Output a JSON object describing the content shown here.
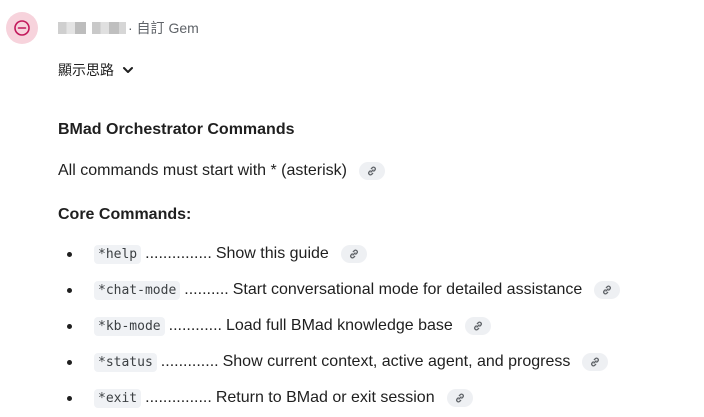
{
  "header": {
    "author_suffix": "· 自訂 Gem"
  },
  "thinking": {
    "label": "顯示思路"
  },
  "content": {
    "title": "BMad Orchestrator Commands",
    "intro": "All commands must start with * (asterisk)",
    "section_title": "Core Commands:",
    "commands": [
      {
        "code": "*help",
        "leader": "...............",
        "description": "Show this guide"
      },
      {
        "code": "*chat-mode",
        "leader": "..........",
        "description": "Start conversational mode for detailed assistance"
      },
      {
        "code": "*kb-mode",
        "leader": "............",
        "description": "Load full BMad knowledge base"
      },
      {
        "code": "*status",
        "leader": ".............",
        "description": "Show current context, active agent, and progress"
      },
      {
        "code": "*exit",
        "leader": "...............",
        "description": "Return to BMad or exit session"
      }
    ]
  },
  "icons": {
    "avatar": "gem-avatar-icon",
    "chevron": "chevron-down-icon",
    "link": "link-icon"
  },
  "colors": {
    "avatar_bg": "#f7d3dc",
    "avatar_icon": "#c2185b",
    "chip_bg": "#eef0f3",
    "code_bg": "#f0f2f5"
  }
}
